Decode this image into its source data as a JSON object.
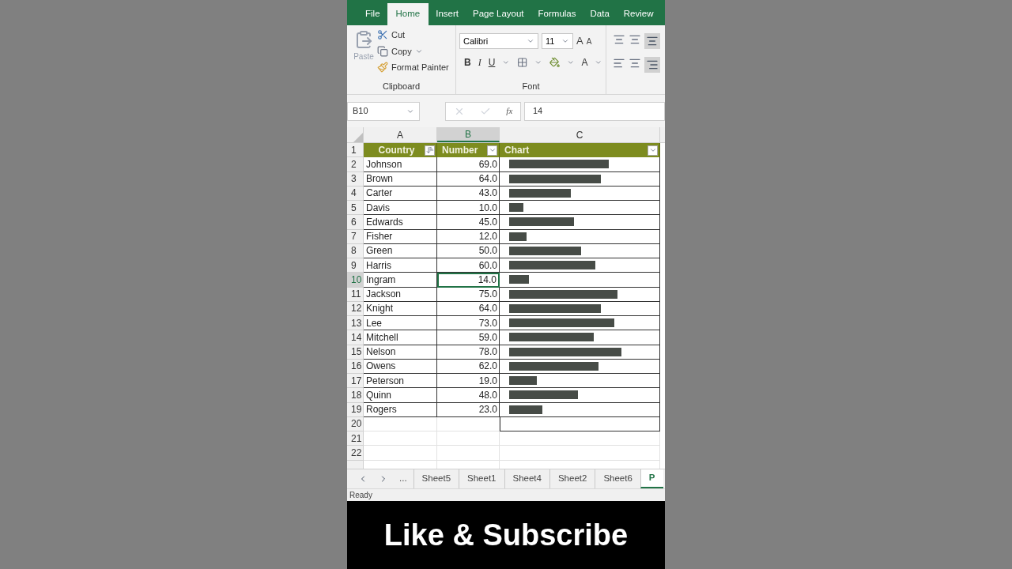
{
  "ribbon_tabs": [
    {
      "label": "File",
      "selected": false
    },
    {
      "label": "Home",
      "selected": true
    },
    {
      "label": "Insert",
      "selected": false
    },
    {
      "label": "Page Layout",
      "selected": false
    },
    {
      "label": "Formulas",
      "selected": false
    },
    {
      "label": "Data",
      "selected": false
    },
    {
      "label": "Review",
      "selected": false
    }
  ],
  "clipboard": {
    "paste": "Paste",
    "cut": "Cut",
    "copy": "Copy",
    "format_painter": "Format Painter",
    "group": "Clipboard"
  },
  "font": {
    "name": "Calibri",
    "size": "11",
    "grow": "A",
    "shrink": "A",
    "bold": "B",
    "italic": "I",
    "underline": "U",
    "font_color_label": "A",
    "group": "Font"
  },
  "formula_bar": {
    "name_box": "B10",
    "fx": "fx",
    "value": "14"
  },
  "columns": [
    {
      "label": "A",
      "selected": false
    },
    {
      "label": "B",
      "selected": true
    },
    {
      "label": "C",
      "selected": false
    }
  ],
  "header_row": {
    "number": "1",
    "cells": [
      "Country",
      "Number",
      "Chart"
    ]
  },
  "rows": [
    {
      "number": "2",
      "name": "Johnson",
      "value": "69.0",
      "selected": false
    },
    {
      "number": "3",
      "name": "Brown",
      "value": "64.0",
      "selected": false
    },
    {
      "number": "4",
      "name": "Carter",
      "value": "43.0",
      "selected": false
    },
    {
      "number": "5",
      "name": "Davis",
      "value": "10.0",
      "selected": false
    },
    {
      "number": "6",
      "name": "Edwards",
      "value": "45.0",
      "selected": false
    },
    {
      "number": "7",
      "name": "Fisher",
      "value": "12.0",
      "selected": false
    },
    {
      "number": "8",
      "name": "Green",
      "value": "50.0",
      "selected": false
    },
    {
      "number": "9",
      "name": "Harris",
      "value": "60.0",
      "selected": false
    },
    {
      "number": "10",
      "name": "Ingram",
      "value": "14.0",
      "selected": true
    },
    {
      "number": "11",
      "name": "Jackson",
      "value": "75.0",
      "selected": false
    },
    {
      "number": "12",
      "name": "Knight",
      "value": "64.0",
      "selected": false
    },
    {
      "number": "13",
      "name": "Lee",
      "value": "73.0",
      "selected": false
    },
    {
      "number": "14",
      "name": "Mitchell",
      "value": "59.0",
      "selected": false
    },
    {
      "number": "15",
      "name": "Nelson",
      "value": "78.0",
      "selected": false
    },
    {
      "number": "16",
      "name": "Owens",
      "value": "62.0",
      "selected": false
    },
    {
      "number": "17",
      "name": "Peterson",
      "value": "19.0",
      "selected": false
    },
    {
      "number": "18",
      "name": "Quinn",
      "value": "48.0",
      "selected": false
    },
    {
      "number": "19",
      "name": "Rogers",
      "value": "23.0",
      "selected": false
    }
  ],
  "empty_rows": [
    "20",
    "21",
    "22"
  ],
  "sheet_tabs": {
    "more": "...",
    "tabs": [
      {
        "label": "Sheet5",
        "selected": false
      },
      {
        "label": "Sheet1",
        "selected": false
      },
      {
        "label": "Sheet4",
        "selected": false
      },
      {
        "label": "Sheet2",
        "selected": false
      },
      {
        "label": "Sheet6",
        "selected": false
      },
      {
        "label": "P",
        "selected": true
      }
    ]
  },
  "status_bar": "Ready",
  "caption": "Like & Subscribe"
}
